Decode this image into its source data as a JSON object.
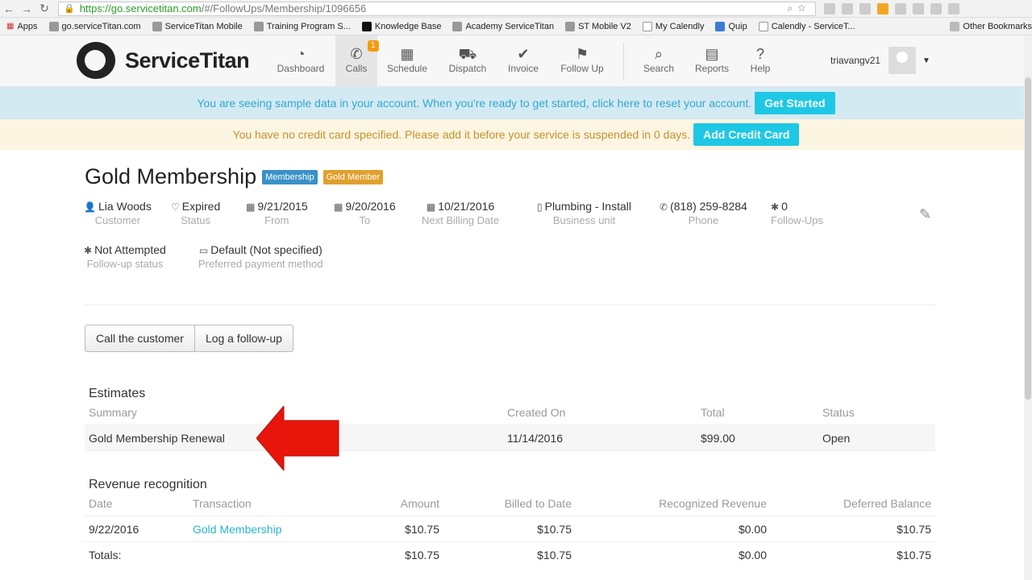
{
  "browser": {
    "url_host": "https://go.servicetitan.com",
    "url_path": "/#/FollowUps/Membership/1096656",
    "bookmarks": [
      "Apps",
      "go.serviceTitan.com",
      "ServiceTitan Mobile",
      "Training Program S...",
      "Knowledge Base",
      "Academy ServiceTitan",
      "ST Mobile V2",
      "My Calendly",
      "Quip",
      "Calendly - ServiceT..."
    ],
    "other_bookmarks": "Other Bookmarks"
  },
  "header": {
    "logo_text": "ServiceTitan",
    "nav": [
      {
        "label": "Dashboard",
        "icon": "dashboard-icon"
      },
      {
        "label": "Calls",
        "icon": "phone-icon",
        "badge": "1"
      },
      {
        "label": "Schedule",
        "icon": "calendar-icon"
      },
      {
        "label": "Dispatch",
        "icon": "truck-icon"
      },
      {
        "label": "Invoice",
        "icon": "check-circle-icon"
      },
      {
        "label": "Follow Up",
        "icon": "flag-icon"
      },
      {
        "label": "Search",
        "icon": "search-icon"
      },
      {
        "label": "Reports",
        "icon": "book-icon"
      },
      {
        "label": "Help",
        "icon": "help-icon"
      }
    ],
    "username": "triavangv21"
  },
  "banners": {
    "sample_text": "You are seeing sample data in your account. When you're ready to get started, click here to reset your account.",
    "get_started": "Get Started",
    "credit_text": "You have no credit card specified. Please add it before your service is suspended in 0 days.",
    "add_credit_card": "Add Credit Card"
  },
  "membership": {
    "title": "Gold Membership",
    "tags": [
      "Membership",
      "Gold Member"
    ],
    "fields": [
      {
        "value": "Lia Woods",
        "label": "Customer"
      },
      {
        "value": "Expired",
        "label": "Status"
      },
      {
        "value": "9/21/2015",
        "label": "From"
      },
      {
        "value": "9/20/2016",
        "label": "To"
      },
      {
        "value": "10/21/2016",
        "label": "Next Billing Date"
      },
      {
        "value": "Plumbing - Install",
        "label": "Business unit"
      },
      {
        "value": "(818) 259-8284",
        "label": "Phone"
      },
      {
        "value": "0",
        "label": "Follow-Ups"
      },
      {
        "value": "Not Attempted",
        "label": "Follow-up status"
      },
      {
        "value": "Default (Not specified)",
        "label": "Preferred payment method"
      }
    ],
    "actions": [
      "Call the customer",
      "Log a follow-up"
    ]
  },
  "estimates": {
    "title": "Estimates",
    "columns": [
      "Summary",
      "Created On",
      "Total",
      "Status"
    ],
    "rows": [
      {
        "summary": "Gold Membership Renewal",
        "created_on": "11/14/2016",
        "total": "$99.00",
        "status": "Open"
      }
    ]
  },
  "revenue": {
    "title": "Revenue recognition",
    "columns": [
      "Date",
      "Transaction",
      "Amount",
      "Billed to Date",
      "Recognized Revenue",
      "Deferred Balance"
    ],
    "rows": [
      {
        "date": "9/22/2016",
        "transaction": "Gold Membership",
        "amount": "$10.75",
        "billed": "$10.75",
        "recognized": "$0.00",
        "deferred": "$10.75"
      }
    ],
    "totals": {
      "label": "Totals:",
      "amount": "$10.75",
      "billed": "$10.75",
      "recognized": "$0.00",
      "deferred": "$10.75"
    }
  },
  "colors": {
    "accent": "#1ec8e5",
    "arrow": "#e8150a",
    "tag_blue": "#3a91c9",
    "tag_gold": "#e0a02e"
  }
}
